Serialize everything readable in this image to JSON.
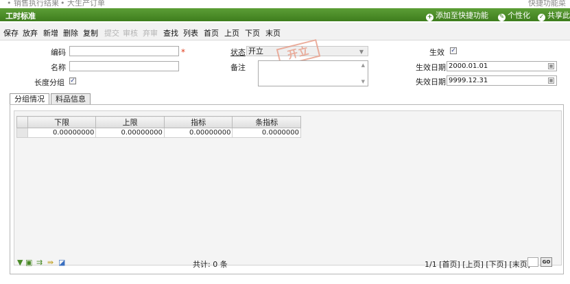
{
  "crumbs": {
    "item1": "• 销售执行结果",
    "item2": "• 大生产订单",
    "right": "快捷功能菜"
  },
  "header": {
    "title": "工时标准",
    "links": [
      {
        "label": "添加至快捷功能",
        "icon": "plus-circle-icon"
      },
      {
        "label": "个性化",
        "icon": "pencil-circle-icon"
      },
      {
        "label": "共享此功",
        "icon": "check-circle-icon"
      }
    ]
  },
  "toolbar": {
    "save": "保存",
    "discard": "放弃",
    "add": "新增",
    "delete": "删除",
    "copy": "复制",
    "submit": "提交",
    "review": "审核",
    "abandon": "弃审",
    "find": "查找",
    "list": "列表",
    "first": "首页",
    "prev": "上页",
    "next": "下页",
    "last": "末页"
  },
  "form": {
    "code_label": "编码",
    "code_value": "",
    "name_label": "名称",
    "name_value": "",
    "length_group_label": "长度分组",
    "status_label": "状态",
    "status_value": "开立",
    "remark_label": "备注",
    "remark_value": "",
    "stamp": "开立",
    "effective_label": "生效",
    "effective_date_label": "生效日期",
    "effective_date_value": "2000.01.01",
    "expire_date_label": "失效日期",
    "expire_date_value": "9999.12.31"
  },
  "tabs": [
    {
      "label": "分组情况"
    },
    {
      "label": "料品信息"
    }
  ],
  "grid": {
    "columns": [
      "下限",
      "上限",
      "指标",
      "条指标"
    ],
    "rows": [
      [
        "0.00000000",
        "0.00000000",
        "0.00000000",
        "0.0000000"
      ]
    ]
  },
  "footer": {
    "total": "共计: 0 条",
    "pager": "1/1 [首页] [上页] [下页] [末页]",
    "go": "GO"
  },
  "colors": {
    "header_green": "#4a8a27",
    "required_star": "#e03a1a"
  }
}
